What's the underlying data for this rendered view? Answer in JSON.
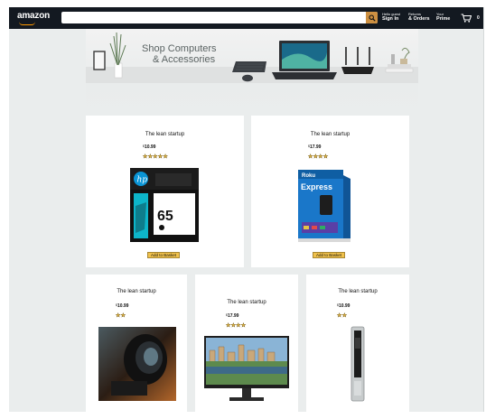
{
  "header": {
    "logo": "amazon",
    "search": {
      "value": "",
      "placeholder": ""
    },
    "options": [
      {
        "line1": "Hello guest",
        "line2": "Sign In"
      },
      {
        "line1": "Returns",
        "line2": "& Orders"
      },
      {
        "line1": "Your",
        "line2": "Prime"
      }
    ],
    "basket_count": "0"
  },
  "banner": {
    "line1": "Shop Computers",
    "line2": "& Accessories"
  },
  "products": [
    {
      "title": "The lean startup",
      "currency": "$",
      "price": "10.99",
      "rating": 5,
      "stars": "★★★★★",
      "button": "Add to Basket",
      "image": "hp-65-ink-cartridge"
    },
    {
      "title": "The lean startup",
      "currency": "$",
      "price": "17.99",
      "rating": 4,
      "stars": "★★★★",
      "button": "Add to Basket",
      "image": "roku-express"
    },
    {
      "title": "The lean startup",
      "currency": "$",
      "price": "10.99",
      "rating": 2,
      "stars": "★★",
      "button": "",
      "image": "camera-lens"
    },
    {
      "title": "The lean startup",
      "currency": "$",
      "price": "17.99",
      "rating": 4,
      "stars": "★★★★",
      "button": "",
      "image": "hp-monitor"
    },
    {
      "title": "The lean startup",
      "currency": "$",
      "price": "10.99",
      "rating": 2,
      "stars": "★★",
      "button": "",
      "image": "ledger-usb-wallet"
    }
  ],
  "colors": {
    "header": "#131921",
    "search_button": "#cd9042",
    "page_bg": "#eaeded",
    "button": "#f0c14b",
    "accent": "#ff9900"
  }
}
